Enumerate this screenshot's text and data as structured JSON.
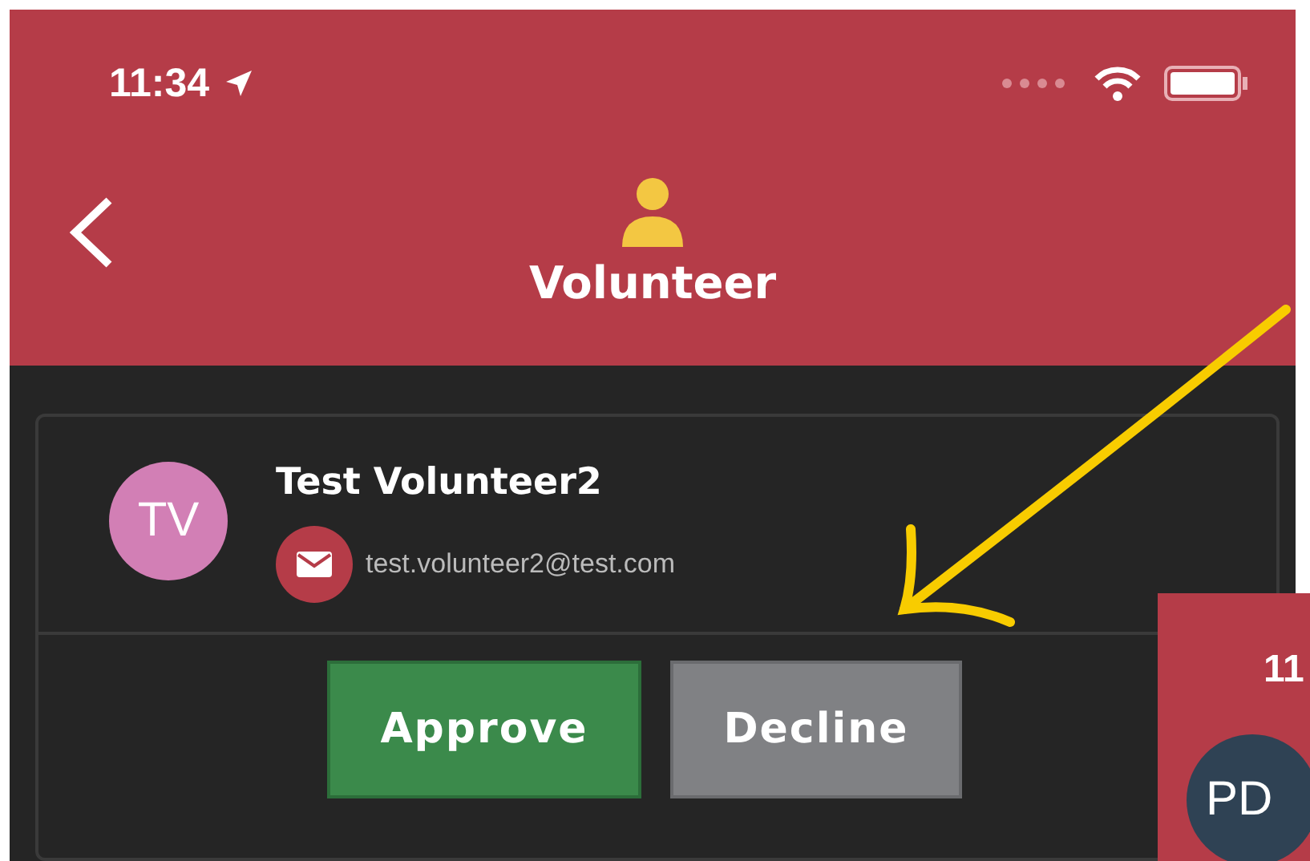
{
  "status_bar": {
    "time": "11:34"
  },
  "header": {
    "title": "Volunteer"
  },
  "card": {
    "initials": "TV",
    "name": "Test Volunteer2",
    "email": "test.volunteer2@test.com",
    "buttons": [
      {
        "label": "Approve",
        "kind": "approve"
      },
      {
        "label": "Decline",
        "kind": "decline"
      }
    ]
  },
  "inset": {
    "time": "11",
    "initials": "PD"
  }
}
